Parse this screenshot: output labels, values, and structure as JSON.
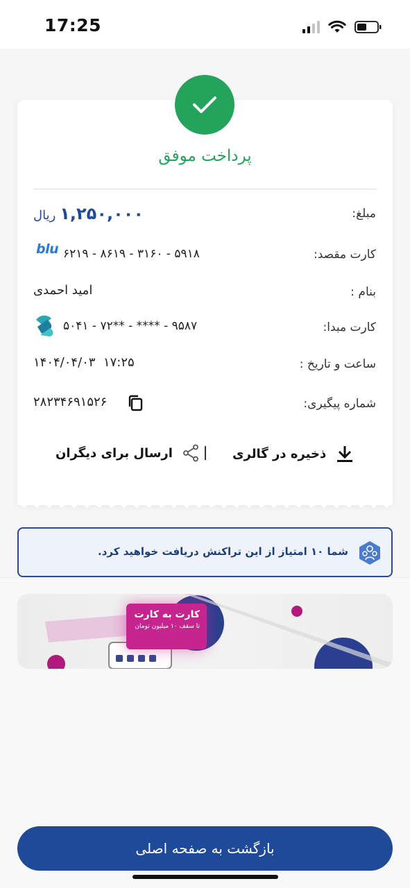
{
  "status_bar": {
    "time": "17:25"
  },
  "receipt": {
    "title": "پرداخت موفق",
    "amount": {
      "label": "مبلغ:",
      "value": "۱,۲۵۰,۰۰۰",
      "unit": "ریال"
    },
    "dest_card": {
      "label": "کارت مقصد:",
      "value": "۶۲۱۹ - ۸۶۱۹ - ۳۱۶۰ - ۵۹۱۸",
      "bank": "blu"
    },
    "name": {
      "label": "بنام :",
      "value": "امید احمدی"
    },
    "source_card": {
      "label": "کارت مبدا:",
      "value": "۵۰۴۱ - ۷۲** - **** - ۹۵۸۷"
    },
    "datetime": {
      "label": "ساعت و تاریخ :",
      "value": "۱۴۰۴/۰۴/۰۳  ۱۷:۲۵"
    },
    "tracking": {
      "label": "شماره پیگیری:",
      "value": "۲۸۲۳۴۶۹۱۵۲۶"
    },
    "actions": {
      "save_label": "ذخیره در گالری",
      "share_label": "ارسال برای دیگران"
    }
  },
  "points_banner": {
    "text": "شما ۱۰ امتیاز از این تراکنش دریافت خواهید کرد."
  },
  "promo": {
    "title": "کارت به کارت",
    "subtitle": "تا سقف ۱۰ میلیون تومان"
  },
  "home_button": {
    "label": "بازگشت به صفحه اصلی"
  },
  "colors": {
    "primary": "#1f4a99",
    "success": "#24a35a",
    "promo": "#c6248f"
  }
}
